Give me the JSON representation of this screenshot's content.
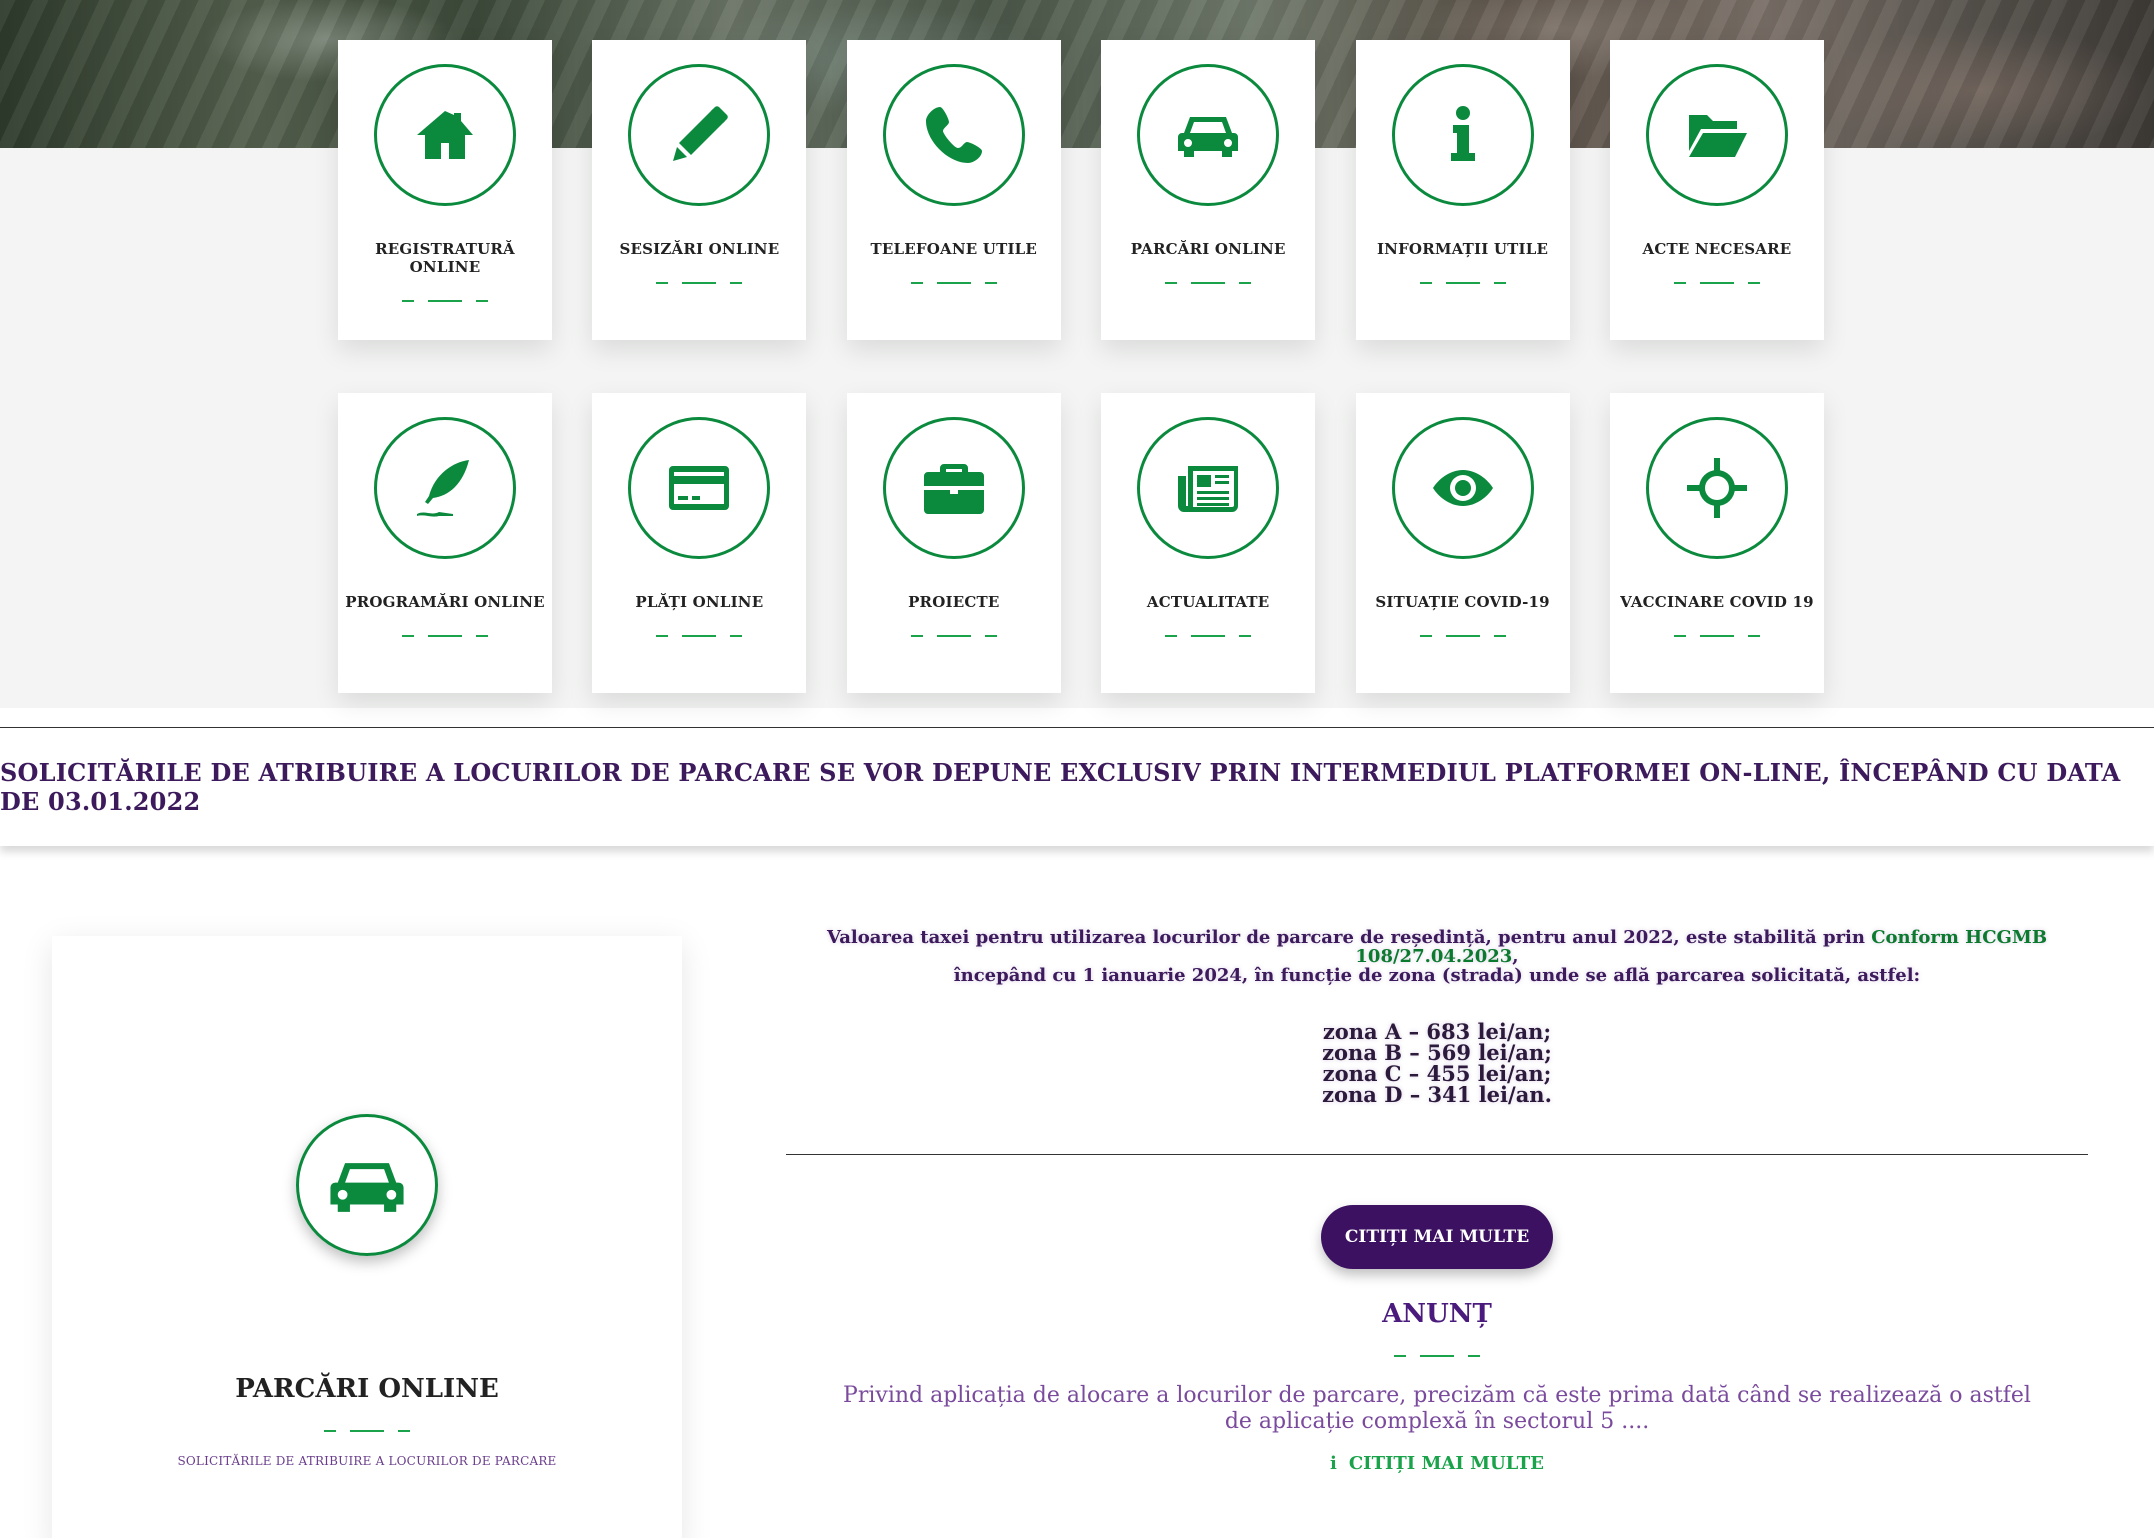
{
  "tiles": [
    {
      "label": "REGISTRATURĂ ONLINE",
      "icon": "home-icon"
    },
    {
      "label": "SESIZĂRI ONLINE",
      "icon": "pencil-icon"
    },
    {
      "label": "TELEFOANE UTILE",
      "icon": "phone-icon"
    },
    {
      "label": "PARCĂRI ONLINE",
      "icon": "car-icon"
    },
    {
      "label": "INFORMAȚII UTILE",
      "icon": "info-icon"
    },
    {
      "label": "ACTE NECESARE",
      "icon": "folder-open-icon"
    },
    {
      "label": "PROGRAMĂRI ONLINE",
      "icon": "feather-icon"
    },
    {
      "label": "PLĂȚI ONLINE",
      "icon": "credit-card-icon"
    },
    {
      "label": "PROIECTE",
      "icon": "briefcase-icon"
    },
    {
      "label": "ACTUALITATE",
      "icon": "newspaper-icon"
    },
    {
      "label": "SITUAȚIE COVID-19",
      "icon": "eye-icon"
    },
    {
      "label": "VACCINARE COVID 19",
      "icon": "crosshair-icon"
    }
  ],
  "banner": {
    "text": "SOLICITĂRILE DE ATRIBUIRE A LOCURILOR DE PARCARE SE VOR DEPUNE EXCLUSIV PRIN INTERMEDIUL PLATFORMEI ON-LINE, ÎNCEPÂND CU DATA DE 03.01.2022"
  },
  "card": {
    "icon": "car-icon",
    "title": "PARCĂRI ONLINE",
    "subtitle": "SOLICITĂRILE DE ATRIBUIRE A LOCURILOR DE PARCARE"
  },
  "fee": {
    "line1_before": "Valoarea taxei pentru utilizarea locurilor de parcare de reședință, pentru anul 2022, este stabilită prin ",
    "link": "Conform HCGMB 108/27.04.2023",
    "line1_after": ",",
    "line2": "începând cu 1 ianuarie 2024, în funcție de zona (strada) unde se află parcarea solicitată, astfel:",
    "zones": [
      "zona A – 683 lei/an;",
      "zona B – 569 lei/an;",
      "zona C – 455 lei/an;",
      "zona D – 341 lei/an."
    ]
  },
  "read_more_button": "CITIȚI MAI MULTE",
  "announcement": {
    "title": "ANUNȚ",
    "text": "Privind aplicația de alocare a locurilor de parcare, precizăm că este prima dată când se realizează o astfel de aplicație complexă în sectorul 5 ....",
    "link_icon": "info-icon",
    "link_label": "CITIȚI MAI MULTE"
  },
  "colors": {
    "accent_green": "#0b8a3e",
    "purple": "#3c1162",
    "text_purple": "#7a4a9c"
  }
}
